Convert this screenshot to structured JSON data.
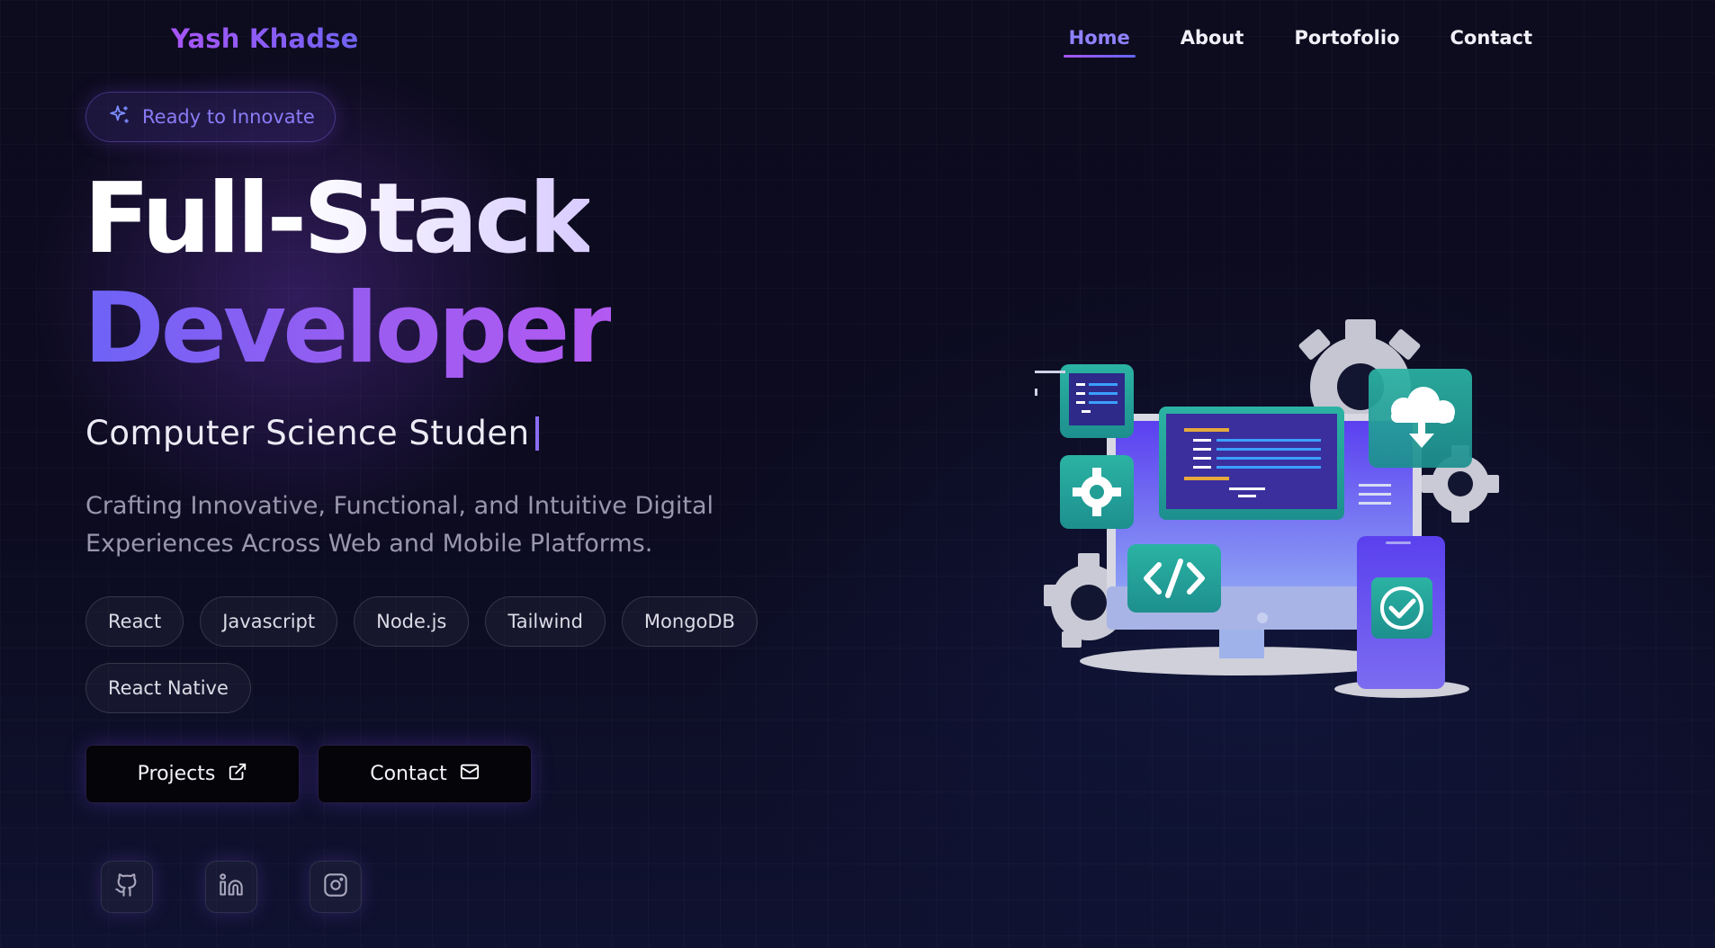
{
  "brand": {
    "name": "Yash Khadse"
  },
  "nav": {
    "items": [
      {
        "label": "Home",
        "active": true
      },
      {
        "label": "About",
        "active": false
      },
      {
        "label": "Portofolio",
        "active": false
      },
      {
        "label": "Contact",
        "active": false
      }
    ]
  },
  "hero": {
    "badge": "Ready to Innovate",
    "title_line1": "Full-Stack",
    "title_line2": "Developer",
    "typed_text": "Computer Science Studen",
    "description_line1": "Crafting Innovative, Functional, and Intuitive Digital",
    "description_line2": "Experiences Across Web and Mobile Platforms.",
    "skills": [
      "React",
      "Javascript",
      "Node.js",
      "Tailwind",
      "MongoDB",
      "React Native"
    ],
    "buttons": {
      "projects": "Projects",
      "contact": "Contact"
    },
    "social": [
      "github-icon",
      "linkedin-icon",
      "instagram-icon"
    ],
    "illustration": "developer-workstation-illustration"
  },
  "colors": {
    "accent_purple": "#a855f7",
    "accent_indigo": "#6366f1",
    "background": "#0c0a1c",
    "teal": "#2bb3a3"
  }
}
